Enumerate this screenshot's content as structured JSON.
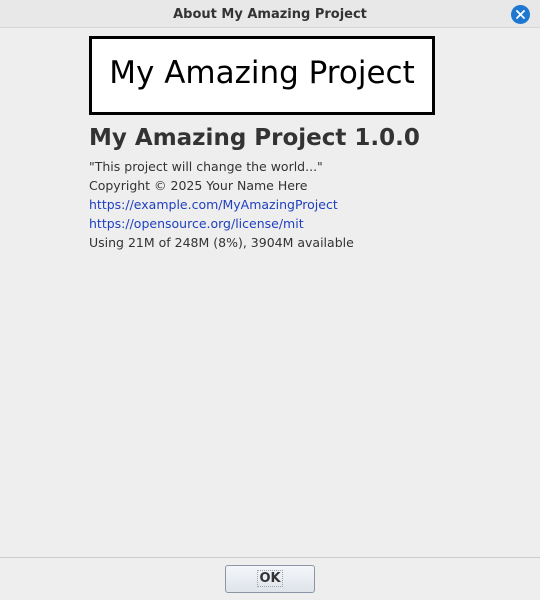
{
  "window": {
    "title": "About My Amazing Project",
    "close_icon": "close-icon"
  },
  "logo": {
    "text": "My Amazing Project"
  },
  "about": {
    "app_name": "My Amazing Project 1.0.0",
    "tagline": "\"This project will change the world...\"",
    "copyright": "Copyright © 2025 Your Name Here",
    "homepage_link": "https://example.com/MyAmazingProject",
    "license_link": "https://opensource.org/license/mit",
    "memory_usage": "Using 21M of 248M (8%), 3904M available"
  },
  "buttons": {
    "ok_label": "OK"
  },
  "colors": {
    "background": "#eeeeee",
    "link": "#1f3fbf",
    "close_button": "#1e78d2",
    "text": "#333333"
  }
}
